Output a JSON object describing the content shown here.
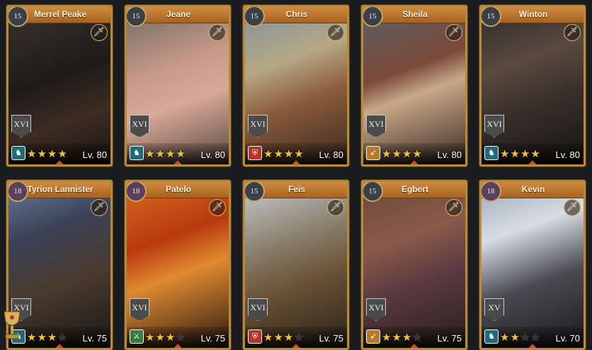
{
  "heroes": [
    {
      "name": "Merrel Peake",
      "star_level": "15",
      "tier": "XVI",
      "class_icon": "horse-icon",
      "class_color": "#1f6b7a",
      "stars": 4,
      "max_stars": 4,
      "level": "Lv. 80",
      "weapon_icon": "sword-icon"
    },
    {
      "name": "Jeane",
      "star_level": "15",
      "tier": "XVI",
      "class_icon": "horse-icon",
      "class_color": "#1f6b7a",
      "stars": 4,
      "max_stars": 4,
      "level": "Lv. 80",
      "weapon_icon": "sword-icon"
    },
    {
      "name": "Chris",
      "star_level": "15",
      "tier": "XVI",
      "class_icon": "shield-icon",
      "class_color": "#b8322a",
      "stars": 4,
      "max_stars": 4,
      "level": "Lv. 80",
      "weapon_icon": "sword-icon"
    },
    {
      "name": "Sheila",
      "star_level": "15",
      "tier": "XVI",
      "class_icon": "bow-icon",
      "class_color": "#b57a2a",
      "stars": 4,
      "max_stars": 4,
      "level": "Lv. 80",
      "weapon_icon": "sword-icon"
    },
    {
      "name": "Winton",
      "star_level": "15",
      "tier": "XVI",
      "class_icon": "horse-icon",
      "class_color": "#1f6b7a",
      "stars": 4,
      "max_stars": 4,
      "level": "Lv. 80",
      "weapon_icon": "sword-icon"
    },
    {
      "name": "Tyrion Lannister",
      "star_level": "18",
      "tier": "XVI",
      "class_icon": "horse-icon",
      "class_color": "#1f6b7a",
      "stars": 3,
      "max_stars": 4,
      "level": "Lv. 75",
      "weapon_icon": "sword-icon"
    },
    {
      "name": "Patelo",
      "star_level": "18",
      "tier": "XVI",
      "class_icon": "pike-icon",
      "class_color": "#3a7a3a",
      "stars": 3,
      "max_stars": 4,
      "level": "Lv. 75",
      "weapon_icon": "sword-icon"
    },
    {
      "name": "Feis",
      "star_level": "15",
      "tier": "XVI",
      "class_icon": "shield-icon",
      "class_color": "#b8322a",
      "stars": 3,
      "max_stars": 4,
      "level": "Lv. 75",
      "weapon_icon": "sword-icon"
    },
    {
      "name": "Egbert",
      "star_level": "15",
      "tier": "XVI",
      "class_icon": "bow-icon",
      "class_color": "#b57a2a",
      "stars": 3,
      "max_stars": 4,
      "level": "Lv. 75",
      "weapon_icon": "sword-icon"
    },
    {
      "name": "Kevin",
      "star_level": "18",
      "tier": "XV",
      "class_icon": "horse-icon",
      "class_color": "#1f6b7a",
      "stars": 2,
      "max_stars": 4,
      "level": "Lv. 70",
      "weapon_icon": "sword-icon"
    }
  ],
  "colors": {
    "frame": "#b58a3c",
    "namebar": "#c07a34",
    "star_on": "#f2c244"
  }
}
